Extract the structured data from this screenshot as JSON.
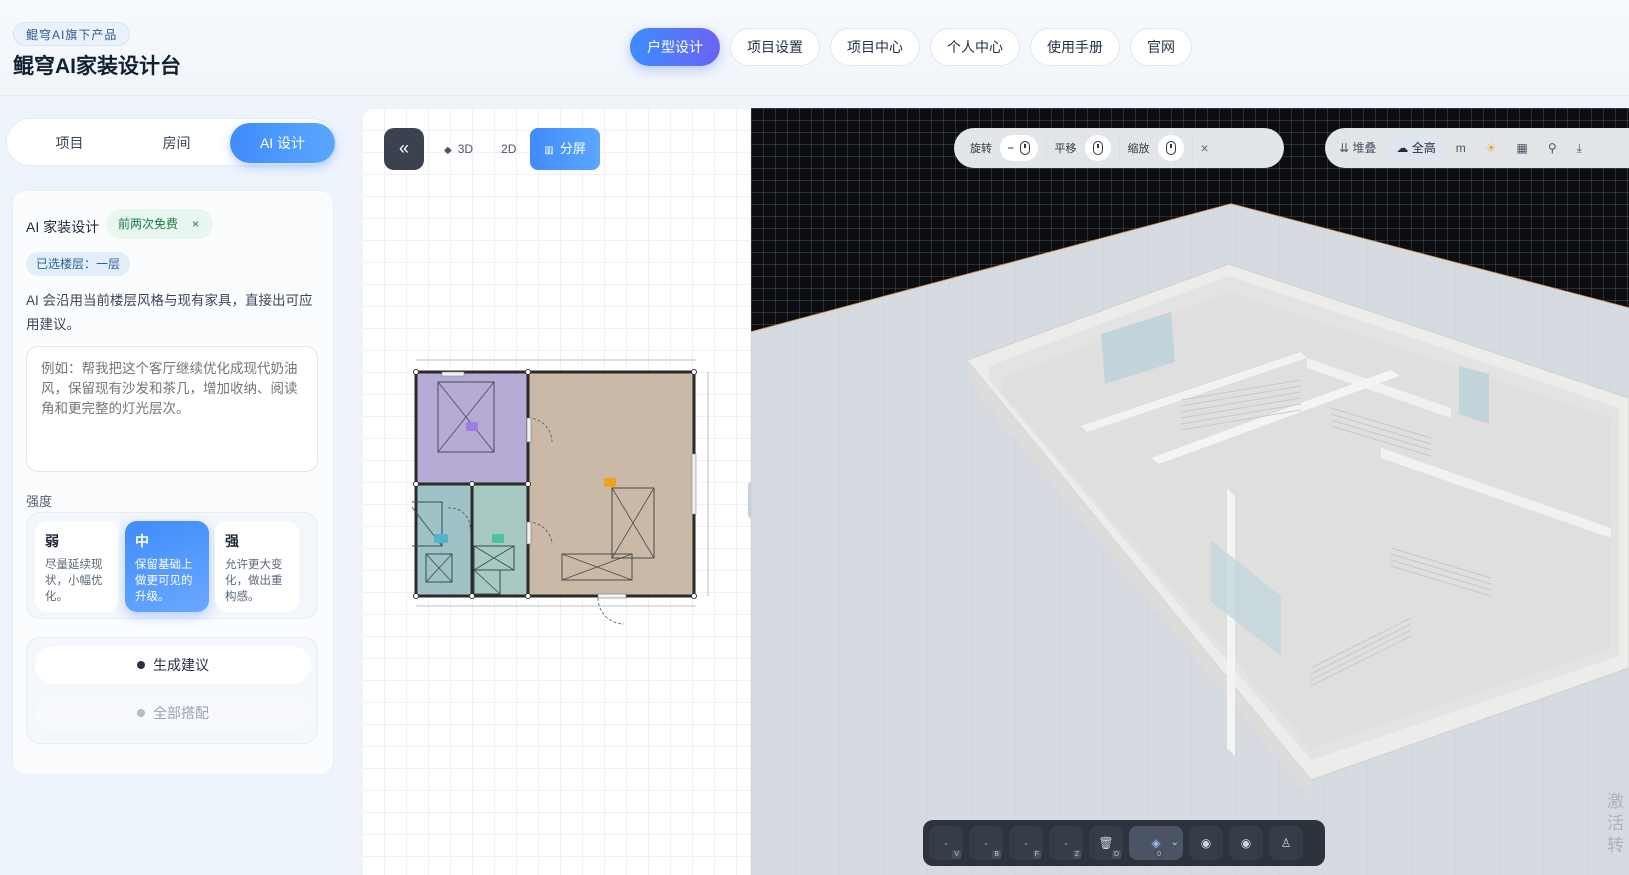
{
  "header": {
    "brand_badge": "鲲穹AI旗下产品",
    "brand_title": "鲲穹AI家装设计台",
    "nav": [
      {
        "label": "户型设计",
        "active": true
      },
      {
        "label": "项目设置"
      },
      {
        "label": "项目中心"
      },
      {
        "label": "个人中心"
      },
      {
        "label": "使用手册"
      },
      {
        "label": "官网"
      }
    ]
  },
  "left_panel": {
    "tabs": [
      "项目",
      "房间",
      "AI 设计"
    ],
    "active_tab": "AI 设计",
    "title": "AI 家装设计",
    "free_tag": "前两次免费",
    "free_tag_close": "×",
    "floor_tag": "已选楼层：一层",
    "description": "AI 会沿用当前楼层风格与现有家具，直接出可应用建议。",
    "prompt_placeholder": "例如：帮我把这个客厅继续优化成现代奶油风，保留现有沙发和茶几，增加收纳、阅读角和更完整的灯光层次。",
    "strength_label": "强度",
    "strength_options": [
      {
        "title": "弱",
        "desc": "尽量延续现状，小幅优化。"
      },
      {
        "title": "中",
        "desc": "保留基础上做更可见的升级。",
        "active": true
      },
      {
        "title": "强",
        "desc": "允许更大变化，做出重构感。"
      }
    ],
    "actions": [
      "生成建议",
      "全部搭配"
    ]
  },
  "plan_panel": {
    "collapse_icon": "«",
    "view_modes": [
      "3D",
      "2D",
      "分屏"
    ],
    "active_view": "分屏",
    "room_colors": {
      "bedroom": "#b5abd4",
      "living": "#c9b9a6",
      "bath": "#9fc2c6",
      "kitchen": "#a8c8c2"
    }
  },
  "viewport": {
    "controls": [
      {
        "label": "旋转"
      },
      {
        "label": "平移"
      },
      {
        "label": "缩放"
      }
    ],
    "close_label": "×",
    "tools": [
      {
        "label": "堆叠",
        "icon": "stack-icon"
      },
      {
        "label": "全高",
        "icon": "full-height-icon",
        "active": true
      },
      {
        "label": "m",
        "icon": "unit-icon"
      },
      {
        "label": "",
        "icon": "sun-icon"
      },
      {
        "label": "",
        "icon": "grid-icon"
      },
      {
        "label": "",
        "icon": "footprint-icon"
      },
      {
        "label": "",
        "icon": "download-icon"
      }
    ],
    "bottom_tools": [
      {
        "key": "V",
        "icon": "select-icon"
      },
      {
        "key": "B",
        "icon": "wall-icon"
      },
      {
        "key": "F",
        "icon": "floor-icon"
      },
      {
        "key": "Z",
        "icon": "zone-icon"
      },
      {
        "key": "D",
        "icon": "delete-icon"
      },
      {
        "key": "0",
        "icon": "layer-icon",
        "active": true
      },
      {
        "key": "",
        "icon": "orbit-icon"
      },
      {
        "key": "",
        "icon": "walk-icon"
      },
      {
        "key": "",
        "icon": "person-icon"
      }
    ],
    "watermark": "激活转"
  }
}
